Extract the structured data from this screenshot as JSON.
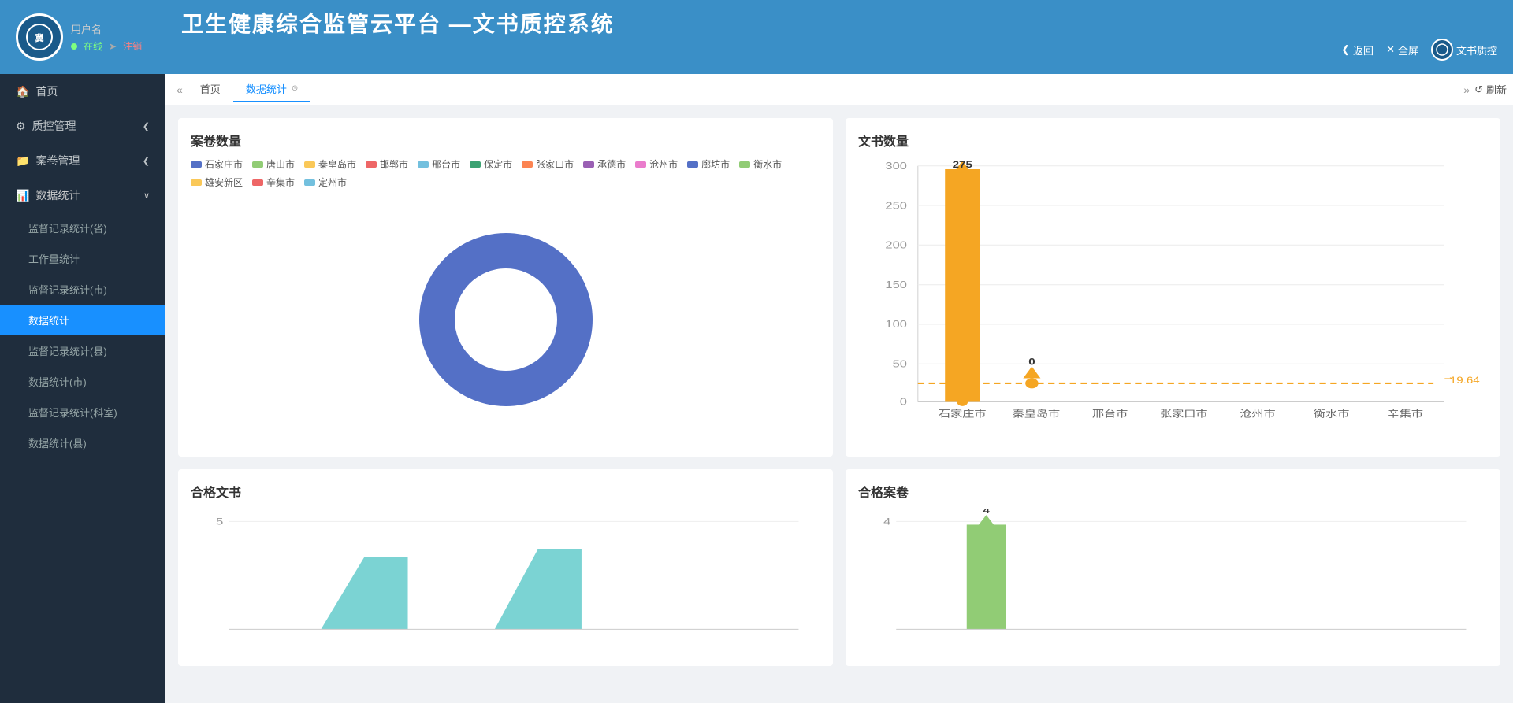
{
  "header": {
    "title": "卫生健康综合监管云平台 —文书质控系统",
    "user_name": "用户名",
    "status_online": "在线",
    "status_logout": "注销",
    "actions": {
      "back": "返回",
      "fullscreen": "全屏",
      "wenshuzhi": "文书质控"
    }
  },
  "nav": {
    "refresh": "刷新"
  },
  "sidebar": {
    "home": "首页",
    "quality_management": "质控管理",
    "case_management": "案卷管理",
    "data_statistics": "数据统计",
    "submenu": [
      "监督记录统计(省)",
      "工作量统计",
      "监督记录统计(市)",
      "数据统计",
      "监督记录统计(县)",
      "数据统计(市)",
      "监督记录统计(科室)",
      "数据统计(县)"
    ]
  },
  "tabs": {
    "home_tab": "首页",
    "data_statistics_tab": "数据统计",
    "close_icon": "×"
  },
  "chart1": {
    "title": "案卷数量",
    "legend": [
      {
        "name": "石家庄市",
        "color": "#5470c6"
      },
      {
        "name": "唐山市",
        "color": "#91cc75"
      },
      {
        "name": "秦皇岛市",
        "color": "#fac858"
      },
      {
        "name": "邯郸市",
        "color": "#ee6666"
      },
      {
        "name": "邢台市",
        "color": "#73c0de"
      },
      {
        "name": "保定市",
        "color": "#3ba272"
      },
      {
        "name": "张家口市",
        "color": "#fc8452"
      },
      {
        "name": "承德市",
        "color": "#9a60b4"
      },
      {
        "name": "沧州市",
        "color": "#ea7ccc"
      },
      {
        "name": "廊坊市",
        "color": "#5470c6"
      },
      {
        "name": "衡水市",
        "color": "#91cc75"
      },
      {
        "name": "雄安新区",
        "color": "#fac858"
      },
      {
        "name": "辛集市",
        "color": "#ee6666"
      },
      {
        "name": "定州市",
        "color": "#73c0de"
      }
    ],
    "donut_color": "#5470c6"
  },
  "chart2": {
    "title": "文书数量",
    "y_labels": [
      "0",
      "50",
      "100",
      "150",
      "200",
      "250",
      "300"
    ],
    "bars": [
      {
        "label": "石家庄市",
        "value": 275,
        "color": "#f5a623",
        "height_pct": 92
      },
      {
        "label": "秦皇岛市",
        "value": 0,
        "color": "#f5a623",
        "height_pct": 0
      },
      {
        "label": "邢台市",
        "value": 0,
        "color": "#f5a623",
        "height_pct": 0
      },
      {
        "label": "张家口市",
        "value": 0,
        "color": "#f5a623",
        "height_pct": 0
      },
      {
        "label": "沧州市",
        "value": 0,
        "color": "#f5a623",
        "height_pct": 0
      },
      {
        "label": "衡水市",
        "value": 0,
        "color": "#f5a623",
        "height_pct": 0
      },
      {
        "label": "辛集市",
        "value": 0,
        "color": "#f5a623",
        "height_pct": 0
      }
    ],
    "avg_line_value": "19.64",
    "first_dot_value": 275,
    "second_dot_value": 0
  },
  "chart3": {
    "title": "合格文书",
    "y_max": 5
  },
  "chart4": {
    "title": "合格案卷",
    "y_max": 4,
    "bar_value": 4
  }
}
